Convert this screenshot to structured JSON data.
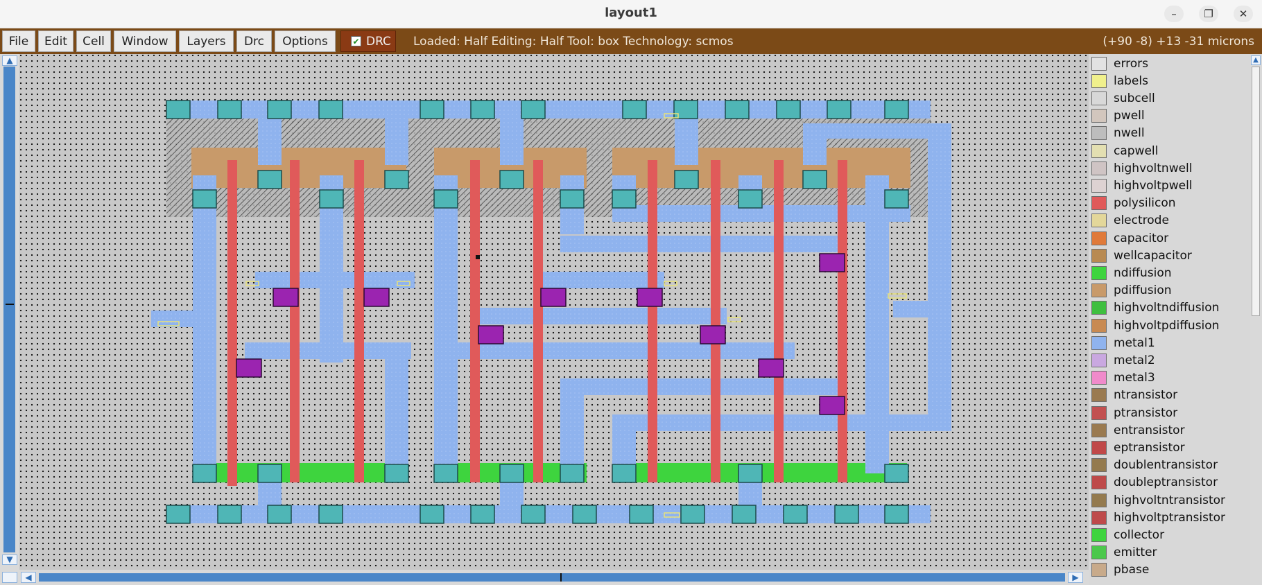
{
  "window": {
    "title": "layout1",
    "controls": {
      "minimize": "–",
      "maximize": "❐",
      "close": "✕"
    }
  },
  "menu": {
    "items": [
      "File",
      "Edit",
      "Cell",
      "Window",
      "Layers",
      "Drc",
      "Options"
    ],
    "drc_label": "DRC",
    "drc_checked": true,
    "status": "Loaded: Half Editing: Half Tool: box Technology: scmos",
    "coords": "(+90 -8) +13 -31 microns"
  },
  "colors": {
    "menubar": "#7b4a17",
    "metal1": "#8fb3ee",
    "polysilicon": "#e05a5a",
    "ndiffusion": "#3ed43e",
    "pdiffusion": "#c89a6a",
    "contact": "#4fb6b6",
    "via": "#9b24b0",
    "scroll": "#4a86c8"
  },
  "layers": [
    {
      "name": "errors",
      "swatch": "#e2e2e2"
    },
    {
      "name": "labels",
      "swatch": "#f0f08c"
    },
    {
      "name": "subcell",
      "swatch": "#d8d8d8"
    },
    {
      "name": "pwell",
      "swatch": "#d2c6bd"
    },
    {
      "name": "nwell",
      "swatch": "#bdbdbd"
    },
    {
      "name": "capwell",
      "swatch": "#e3dfb1"
    },
    {
      "name": "highvoltnwell",
      "swatch": "#cfc4c4"
    },
    {
      "name": "highvoltpwell",
      "swatch": "#ddd2d2"
    },
    {
      "name": "polysilicon",
      "swatch": "#e05a5a"
    },
    {
      "name": "electrode",
      "swatch": "#e3d79a"
    },
    {
      "name": "capacitor",
      "swatch": "#e07a3a"
    },
    {
      "name": "wellcapacitor",
      "swatch": "#b88a52"
    },
    {
      "name": "ndiffusion",
      "swatch": "#3ed43e"
    },
    {
      "name": "pdiffusion",
      "swatch": "#c89a6a"
    },
    {
      "name": "highvoltndiffusion",
      "swatch": "#3fbf3f"
    },
    {
      "name": "highvoltpdiffusion",
      "swatch": "#c88a52"
    },
    {
      "name": "metal1",
      "swatch": "#8fb3ee"
    },
    {
      "name": "metal2",
      "swatch": "#c9a8e0"
    },
    {
      "name": "metal3",
      "swatch": "#f08acb"
    },
    {
      "name": "ntransistor",
      "swatch": "#9a7a50"
    },
    {
      "name": "ptransistor",
      "swatch": "#c25050"
    },
    {
      "name": "entransistor",
      "swatch": "#9a7a50"
    },
    {
      "name": "eptransistor",
      "swatch": "#c04848"
    },
    {
      "name": "doublentransistor",
      "swatch": "#947a4e"
    },
    {
      "name": "doubleptransistor",
      "swatch": "#be4a4a"
    },
    {
      "name": "highvoltntransistor",
      "swatch": "#947a4e"
    },
    {
      "name": "highvoltptransistor",
      "swatch": "#be4a4a"
    },
    {
      "name": "collector",
      "swatch": "#3ed43e"
    },
    {
      "name": "emitter",
      "swatch": "#4cc84c"
    },
    {
      "name": "pbase",
      "swatch": "#c8aa8a"
    }
  ]
}
